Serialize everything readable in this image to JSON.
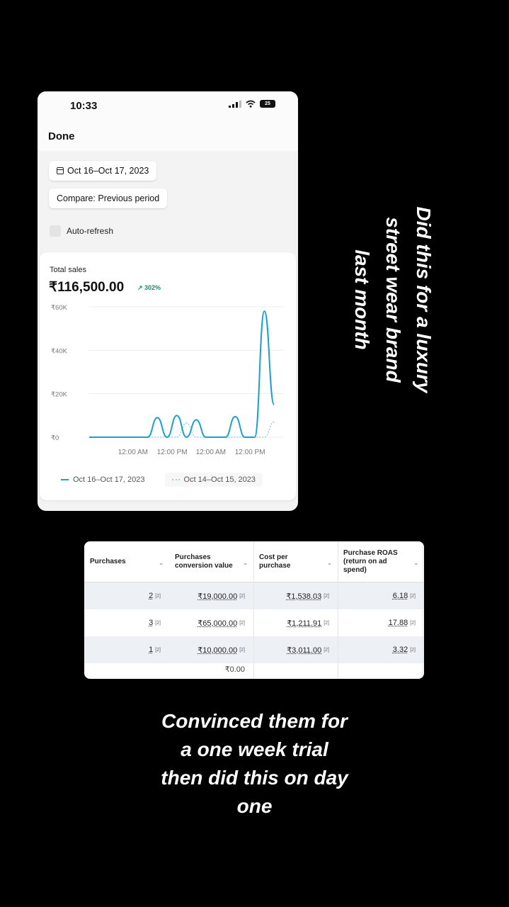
{
  "phone": {
    "time": "10:33",
    "battery": "25",
    "done_label": "Done",
    "date_range": "Oct 16–Oct 17, 2023",
    "compare_label": "Compare: Previous period",
    "auto_refresh_label": "Auto-refresh",
    "total_sales_label": "Total sales",
    "total_sales_value": "₹116,500.00",
    "change": "↗ 302%",
    "legend": [
      "Oct 16–Oct 17, 2023",
      "Oct 14–Oct 15, 2023"
    ]
  },
  "chart_data": {
    "type": "line",
    "y_ticks": [
      "₹60K",
      "₹40K",
      "₹20K",
      "₹0"
    ],
    "x_ticks": [
      "12:00 AM",
      "12:00 PM",
      "12:00 AM",
      "12:00 PM"
    ],
    "ylim": [
      0,
      60000
    ],
    "grid": true,
    "series": [
      {
        "name": "Oct 16–Oct 17, 2023",
        "color": "#1b9fd0",
        "x": [
          0,
          2,
          4,
          6,
          8,
          10,
          12,
          14,
          16,
          18,
          20,
          22,
          24,
          26,
          28,
          30,
          32,
          34,
          36,
          38
        ],
        "values": [
          0,
          0,
          0,
          0,
          0,
          0,
          0,
          9000,
          0,
          10000,
          0,
          8000,
          0,
          0,
          0,
          9500,
          0,
          0,
          58000,
          15000
        ]
      },
      {
        "name": "Oct 14–Oct 15, 2023",
        "color": "#9ad0e6",
        "x": [
          0,
          2,
          4,
          6,
          8,
          10,
          12,
          14,
          16,
          18,
          20,
          22,
          24,
          26,
          28,
          30,
          32,
          34,
          36,
          38
        ],
        "values": [
          0,
          0,
          0,
          0,
          0,
          0,
          0,
          0,
          0,
          0,
          6500,
          0,
          0,
          0,
          0,
          0,
          0,
          0,
          0,
          7000
        ]
      }
    ]
  },
  "caption_vertical": [
    "Did this for a luxury",
    "street wear brand",
    "last month"
  ],
  "table": {
    "headers": [
      [
        "Purchases"
      ],
      [
        "Purchases",
        "conversion value"
      ],
      [
        "Cost per",
        "purchase"
      ],
      [
        "Purchase ROAS",
        "(return on ad",
        "spend)"
      ]
    ],
    "rows": [
      [
        "2",
        "₹19,000.00",
        "₹1,538.03",
        "6.18"
      ],
      [
        "3",
        "₹65,000.00",
        "₹1,211.91",
        "17.88"
      ],
      [
        "1",
        "₹10,000.00",
        "₹3,011.00",
        "3.32"
      ]
    ],
    "partial_row": "₹0.00",
    "footnote_marker": "[2]"
  },
  "caption_bottom": [
    "Convinced them for",
    "a one week trial",
    "then did this on day",
    "one"
  ]
}
